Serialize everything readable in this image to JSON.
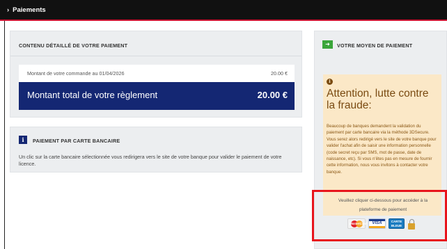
{
  "breadcrumb": {
    "chevron": "›",
    "label": "Paiements"
  },
  "detail_panel": {
    "title": "CONTENU DÉTAILLÉ DE VOTRE PAIEMENT",
    "order_label": "Montant de votre commande au 01/04/2026",
    "order_value": "20.00 €",
    "total_label": "Montant total de votre règlement",
    "total_value": "20.00 €"
  },
  "card_payment_panel": {
    "icon": "i",
    "title": "PAIEMENT PAR CARTE BANCAIRE",
    "description": "Un clic sur la carte bancaire sélectionnée vous redirigera vers le site de votre banque pour valider le paiement de votre licence."
  },
  "method_panel": {
    "icon": "arrow-right-icon",
    "title": "VOTRE MOYEN DE PAIEMENT",
    "alert": {
      "icon": "i",
      "heading": "Attention, lutte contre la fraude:",
      "body": "Beaucoup de banques demandent la validation du paiement par carte bancaire via la méthode 3DSecure. Vous serez alors redirigé vers le site de votre banque pour valider l'achat afin de saisir une information personnelle (code secret reçu par SMS, mot de passe, date de naissance, etc). Si vous n'êtes pas en mesure de fournir cette information, nous vous invitons à contacter votre banque."
    },
    "click_note": "Veuillez cliquer ci-dessous pour accéder à la plateforme de paiement",
    "cards": {
      "mastercard": "MasterCard",
      "visa": "VISA",
      "carte_bleue": "CARTE BLEUE"
    }
  },
  "colors": {
    "topbar": "#111111",
    "total_bg": "#142773",
    "alert_bg": "#fbe8c7",
    "alert_text": "#8a5714",
    "highlight_box": "#e8141c",
    "go_icon": "#3aa53a"
  }
}
